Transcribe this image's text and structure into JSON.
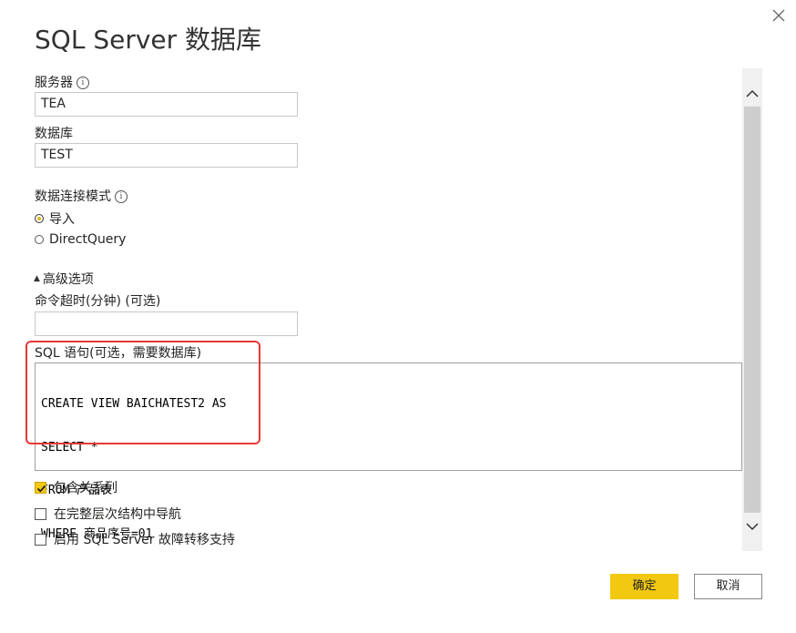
{
  "dialog": {
    "title": "SQL Server 数据库"
  },
  "server": {
    "label": "服务器",
    "value": "TEA"
  },
  "database": {
    "label": "数据库",
    "value": "TEST"
  },
  "connectivity": {
    "label": "数据连接模式",
    "options": [
      {
        "label": "导入",
        "selected": true
      },
      {
        "label": "DirectQuery",
        "selected": false
      }
    ]
  },
  "advanced": {
    "toggle_label": "高级选项",
    "timeout_label": "命令超时(分钟) (可选)",
    "timeout_value": "",
    "sql_label": "SQL 语句(可选，需要数据库)",
    "sql_lines": [
      "CREATE VIEW BAICHATEST2 AS",
      "SELECT *",
      "FROM 产品表",
      "WHERE 商品序号=01"
    ],
    "options": [
      {
        "label": "包含关系列",
        "checked": true
      },
      {
        "label": "在完整层次结构中导航",
        "checked": false
      },
      {
        "label": "启用 SQL Server 故障转移支持",
        "checked": false
      }
    ]
  },
  "buttons": {
    "ok": "确定",
    "cancel": "取消"
  },
  "colors": {
    "accent": "#f2c811",
    "highlight": "#e53935"
  },
  "icons": {
    "close": "close-icon",
    "info": "info-icon",
    "collapse": "triangle-up-icon"
  }
}
